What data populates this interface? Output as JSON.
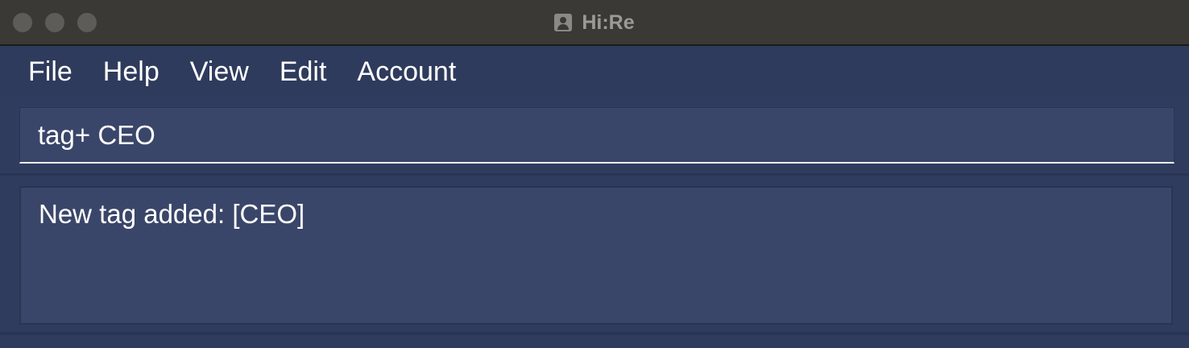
{
  "window": {
    "title": "Hi:Re",
    "app_icon": "person-icon"
  },
  "menubar": {
    "items": [
      {
        "label": "File"
      },
      {
        "label": "Help"
      },
      {
        "label": "View"
      },
      {
        "label": "Edit"
      },
      {
        "label": "Account"
      }
    ]
  },
  "command": {
    "value": "tag+ CEO",
    "placeholder": ""
  },
  "result": {
    "text": "New tag added: [CEO]"
  },
  "colors": {
    "titlebar": "#3a3936",
    "menubar": "#2f3b5c",
    "panel": "#3a4669",
    "text": "#ffffff"
  }
}
